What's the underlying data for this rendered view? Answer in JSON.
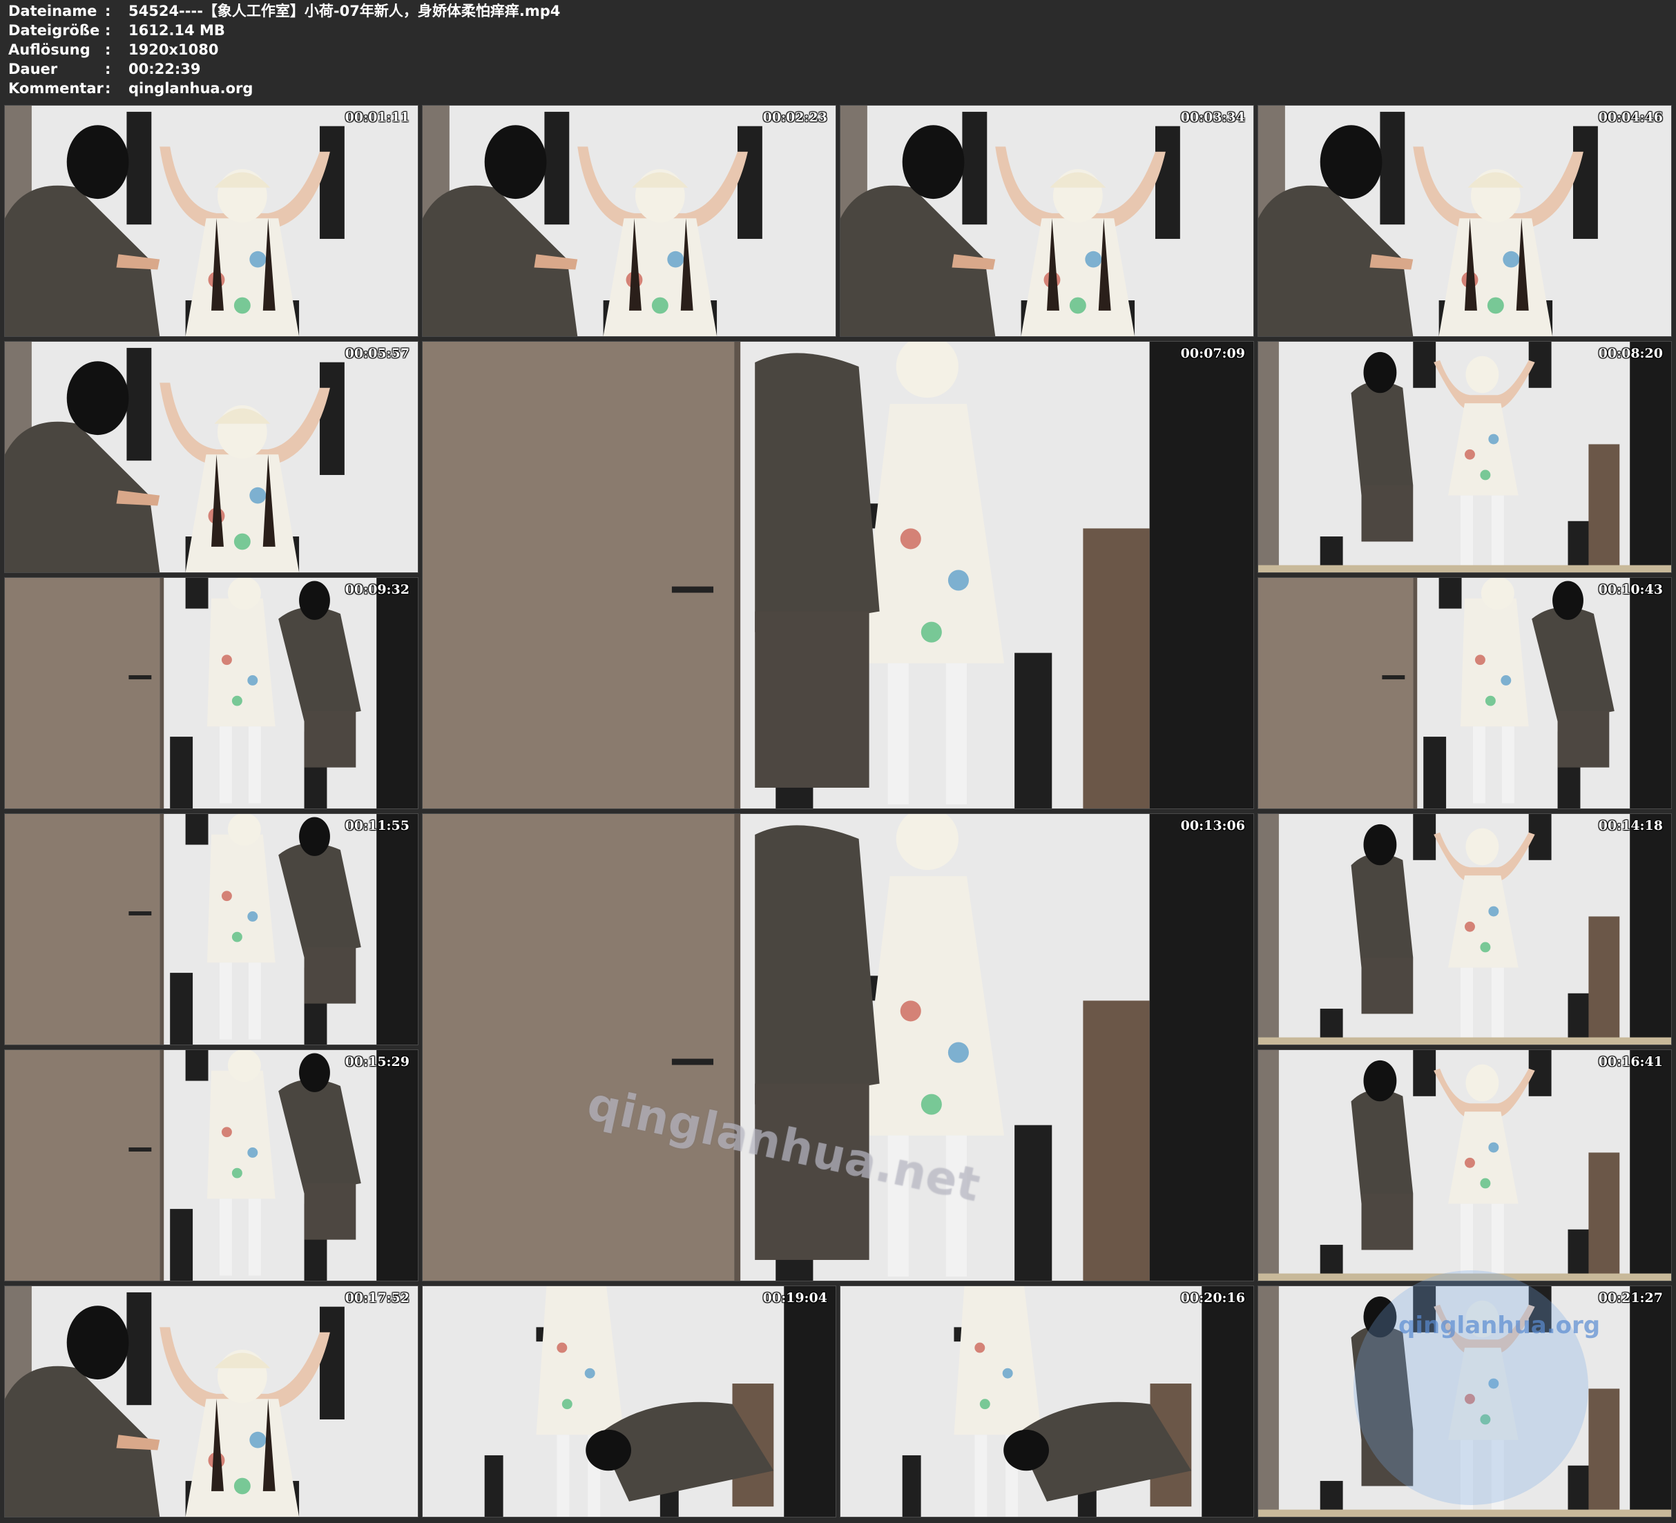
{
  "info": {
    "rows": [
      {
        "key": "Dateiname",
        "sep": ":",
        "value": "54524----【象人工作室】小荷-07年新人，身娇体柔怕痒痒.mp4"
      },
      {
        "key": "Dateigröße",
        "sep": ":",
        "value": "1612.14 MB"
      },
      {
        "key": "Auflösung",
        "sep": ":",
        "value": "1920x1080"
      },
      {
        "key": "Dauer",
        "sep": ":",
        "value": "00:22:39"
      },
      {
        "key": "Kommentar",
        "sep": ":",
        "value": "qinglanhua.org"
      }
    ]
  },
  "thumbnails": [
    {
      "time": "00:01:11",
      "scene": "wall-hands"
    },
    {
      "time": "00:02:23",
      "scene": "wall-hands"
    },
    {
      "time": "00:03:34",
      "scene": "wall-hands"
    },
    {
      "time": "00:04:46",
      "scene": "wall-hands"
    },
    {
      "time": "00:05:57",
      "scene": "wall-hands"
    },
    {
      "time": "00:07:09",
      "scene": "door-wide"
    },
    {
      "time": "00:08:20",
      "scene": "wall-full"
    },
    {
      "time": "00:09:32",
      "scene": "door-full"
    },
    {
      "time": "00:10:43",
      "scene": "door-full"
    },
    {
      "time": "00:11:55",
      "scene": "door-full"
    },
    {
      "time": "00:13:06",
      "scene": "door-wide"
    },
    {
      "time": "00:14:18",
      "scene": "wall-full"
    },
    {
      "time": "00:15:29",
      "scene": "door-full"
    },
    {
      "time": "00:16:41",
      "scene": "wall-full"
    },
    {
      "time": "00:17:52",
      "scene": "wall-hands"
    },
    {
      "time": "00:19:04",
      "scene": "bend"
    },
    {
      "time": "00:20:16",
      "scene": "bend"
    },
    {
      "time": "00:21:27",
      "scene": "wall-full"
    }
  ],
  "watermarks": {
    "center": "qinglanhua.net",
    "corner": "qinglanhua.org"
  },
  "colors": {
    "background": "#2b2b2b",
    "wall": "#e9e9e9",
    "door": "#8a7b6e",
    "post": "#1f1f1f",
    "shirt": "#4a4640",
    "dress": "#f2efe6",
    "text": "#ffffff"
  }
}
